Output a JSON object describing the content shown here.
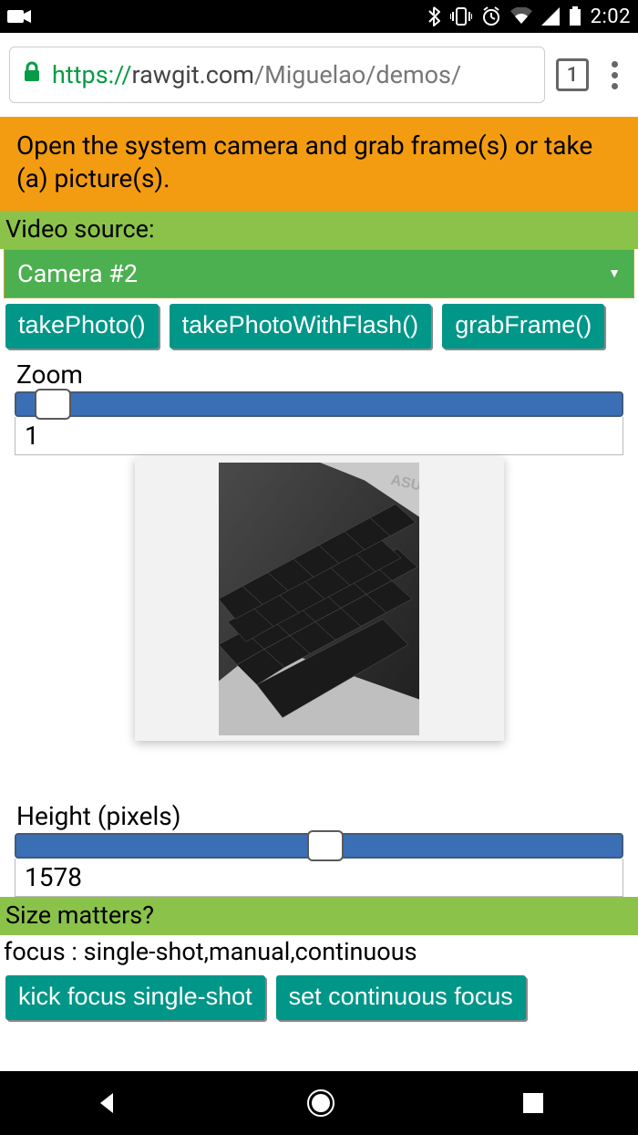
{
  "status": {
    "clock": "2:02"
  },
  "browser": {
    "url_scheme": "https://",
    "url_host": "rawgit.com",
    "url_path": "/Miguelao/demos/",
    "tab_count": "1"
  },
  "page": {
    "banner": "Open the system camera and grab frame(s) or take (a) picture(s).",
    "video_source_label": "Video source:",
    "video_source_selected": "Camera #2",
    "buttons": {
      "take_photo": "takePhoto()",
      "take_photo_flash": "takePhotoWithFlash()",
      "grab_frame": "grabFrame()"
    },
    "zoom": {
      "label": "Zoom",
      "value": "1",
      "thumb_percent": 3
    },
    "height": {
      "label": "Height (pixels)",
      "value": "1578",
      "thumb_percent": 48
    },
    "size_matters_label": "Size matters?",
    "focus_modes_line": "focus : single-shot,manual,continuous",
    "focus_buttons": {
      "kick_single": "kick focus single-shot",
      "set_continuous": "set continuous focus"
    }
  }
}
